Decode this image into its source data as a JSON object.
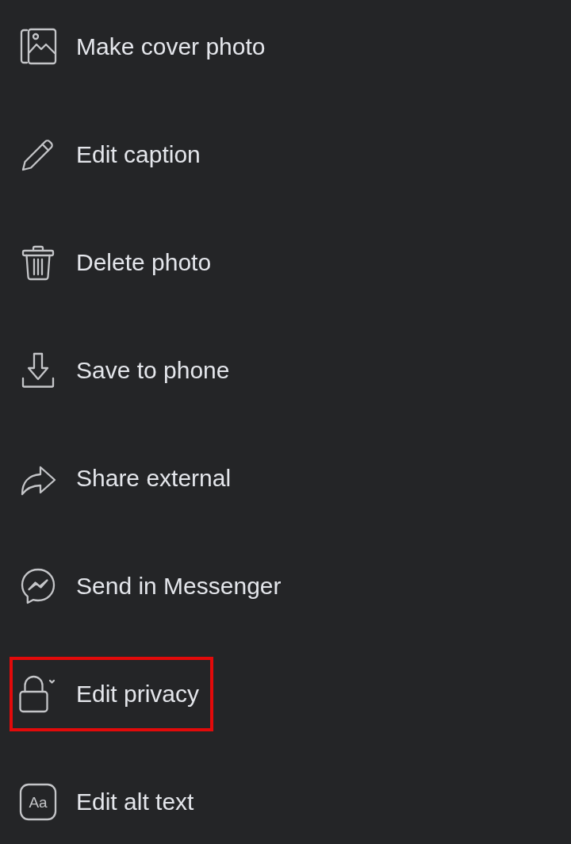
{
  "menu": {
    "items": [
      {
        "label": "Make cover photo",
        "highlighted": false
      },
      {
        "label": "Edit caption",
        "highlighted": false
      },
      {
        "label": "Delete photo",
        "highlighted": false
      },
      {
        "label": "Save to phone",
        "highlighted": false
      },
      {
        "label": "Share external",
        "highlighted": false
      },
      {
        "label": "Send in Messenger",
        "highlighted": false
      },
      {
        "label": "Edit privacy",
        "highlighted": true
      },
      {
        "label": "Edit alt text",
        "highlighted": false,
        "icon_text": "Aa"
      }
    ]
  }
}
